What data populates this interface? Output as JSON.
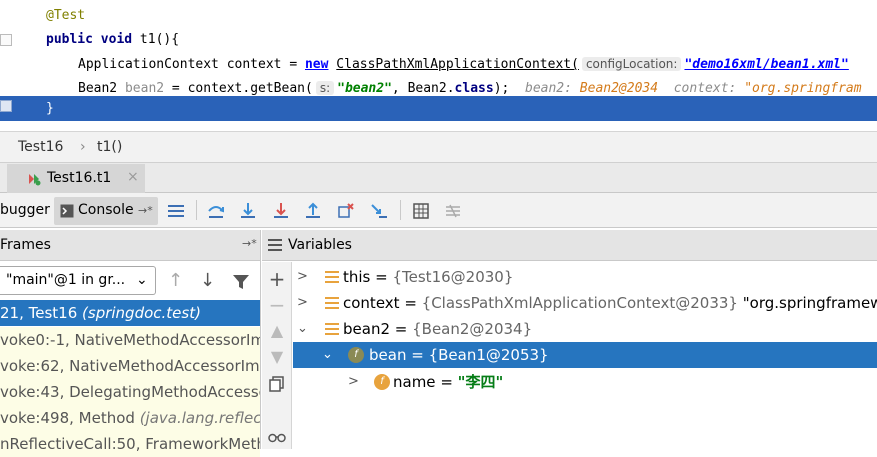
{
  "editor": {
    "line1": "@Test",
    "line2_kw1": "public",
    "line2_kw2": "void",
    "line2_rest": " t1(){",
    "line3_type": "ApplicationContext context = ",
    "line3_new": "new",
    "line3_class": "ClassPathXmlApplicationContext(",
    "line3_hint": "configLocation:",
    "line3_str": "\"demo16xml/bean1.xml\"",
    "line4_type": "Bean2 ",
    "line4_var": "bean2",
    "line4_rest": " = context.getBean(",
    "line4_hint": "s:",
    "line4_str": "\"bean2\"",
    "line4_rest2": ", Bean2.",
    "line4_kw": "class",
    "line4_end": ");",
    "line4_inline1": "bean2: ",
    "line4_inline1_val": "Bean2@2034",
    "line4_inline2": "context: ",
    "line4_inline2_val": "\"org.springfram",
    "line5": "}"
  },
  "breadcrumb": {
    "item1": "Test16",
    "sep": "›",
    "item2": "t1()"
  },
  "session_tab": {
    "label": "Test16.t1",
    "close": "×"
  },
  "toolbar": {
    "debugger_label": "bugger",
    "console_label": "Console",
    "pin": "→*"
  },
  "frames": {
    "header": "Frames",
    "thread": "\"main\"@1 in gr...",
    "items": [
      {
        "text": "21, Test16 ",
        "pkg": "(springdoc.test)"
      },
      {
        "text": "voke0:-1, NativeMethodAccessorImp",
        "pkg": ""
      },
      {
        "text": "voke:62, NativeMethodAccessorImp",
        "pkg": ""
      },
      {
        "text": "voke:43, DelegatingMethodAccesso",
        "pkg": ""
      },
      {
        "text": "voke:498, Method ",
        "pkg": "(java.lang.reflect)"
      },
      {
        "text": "nReflectiveCall:50, FrameworkMetho",
        "pkg": ""
      }
    ]
  },
  "variables": {
    "header": "Variables",
    "rows": [
      {
        "name": "this",
        "eq": " = ",
        "val": "{Test16@2030}",
        "extra": ""
      },
      {
        "name": "context",
        "eq": " = ",
        "val": "{ClassPathXmlApplicationContext@2033}",
        "extra": " \"org.springframework"
      },
      {
        "name": "bean2",
        "eq": " = ",
        "val": "{Bean2@2034}",
        "extra": ""
      },
      {
        "name": "bean",
        "eq": " = ",
        "val": "{Bean1@2053}",
        "extra": ""
      },
      {
        "name": "name",
        "eq": " = ",
        "val": "",
        "extra": "\"李四\""
      }
    ],
    "field_badge": "f"
  },
  "colors": {
    "selection": "#2675bf",
    "current_line": "#2a62b8",
    "frame_bg": "#fdfde6",
    "field_icon": "#e8a33d"
  }
}
